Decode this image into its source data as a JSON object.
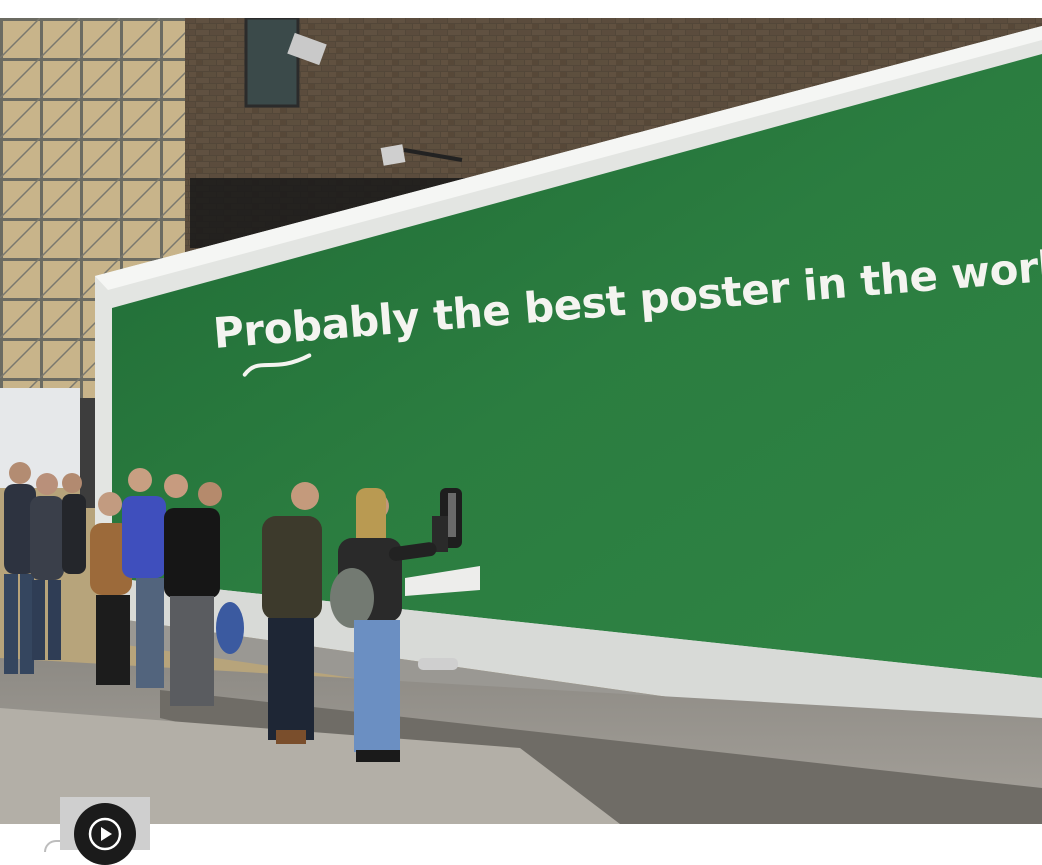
{
  "image": {
    "subject": "photo",
    "billboard_headline": "Probably the best poster in the world"
  },
  "controls": {
    "play_icon": "play-icon"
  },
  "colors": {
    "billboard_green": "#2a7a3e",
    "billboard_frame": "#e4e6e3",
    "headline_text": "#f4f4f0",
    "play_button_bg": "#cfcfcf",
    "play_circle": "#1b1b1b"
  }
}
